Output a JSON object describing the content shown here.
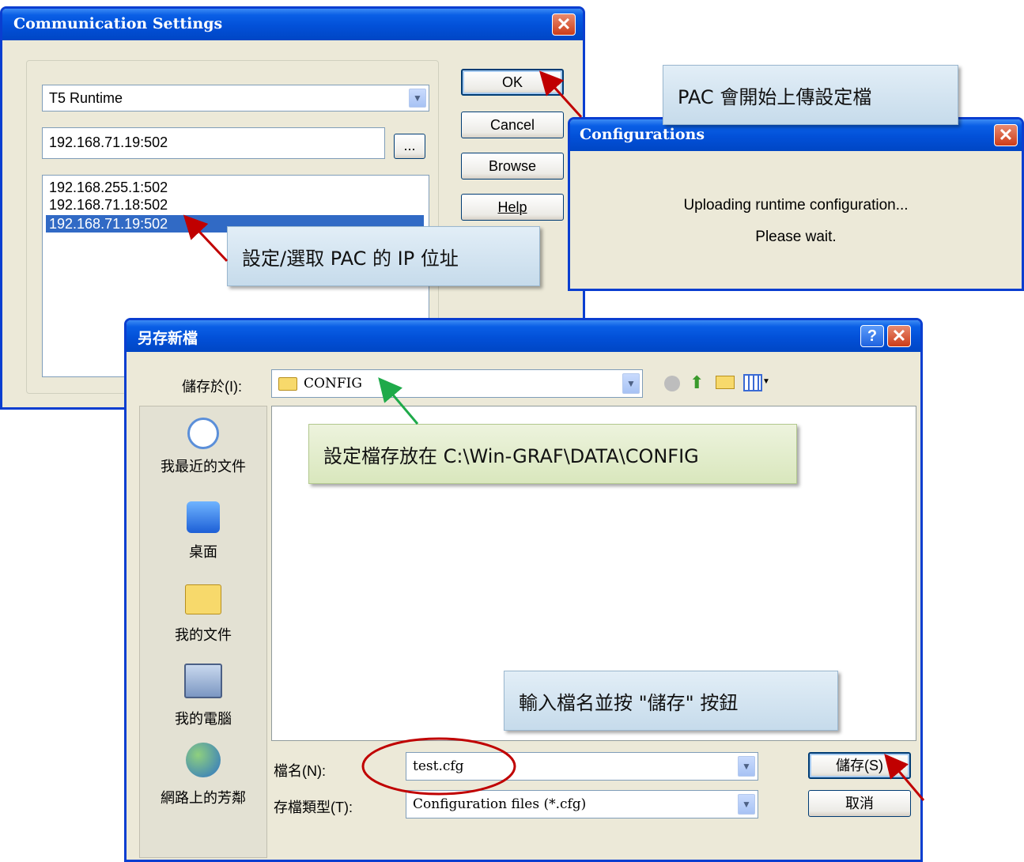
{
  "comm_dialog": {
    "title": "Communication Settings",
    "driver_value": "T5 Runtime",
    "address_value": "192.168.71.19:502",
    "browse_small_label": "...",
    "address_list": [
      "192.168.255.1:502",
      "192.168.71.18:502",
      "192.168.71.19:502"
    ],
    "buttons": {
      "ok": "OK",
      "cancel": "Cancel",
      "browse": "Browse",
      "help": "Help"
    }
  },
  "config_dialog": {
    "title": "Configurations",
    "line1": "Uploading runtime configuration...",
    "line2": "Please wait."
  },
  "save_dialog": {
    "title": "另存新檔",
    "save_in_label": "儲存於(I):",
    "save_in_value": "CONFIG",
    "places": [
      "我最近的文件",
      "桌面",
      "我的文件",
      "我的電腦",
      "網路上的芳鄰"
    ],
    "filename_label": "檔名(N):",
    "filename_value": "test.cfg",
    "filetype_label": "存檔類型(T):",
    "filetype_value": "Configuration files (*.cfg)",
    "save_button": "儲存(S)",
    "cancel_button": "取消"
  },
  "callouts": {
    "upload": "PAC 會開始上傳設定檔",
    "select_ip": "設定/選取 PAC 的 IP 位址",
    "config_path": "設定檔存放在 C:\\Win-GRAF\\DATA\\CONFIG",
    "enter_name": "輸入檔名並按 \"儲存\" 按鈕"
  },
  "colors": {
    "xp_blue": "#0250d8",
    "callout_blue": "#d4e5f2",
    "callout_green": "#e2edcc",
    "arrow_red": "#c00000",
    "arrow_green": "#1faa4a"
  }
}
